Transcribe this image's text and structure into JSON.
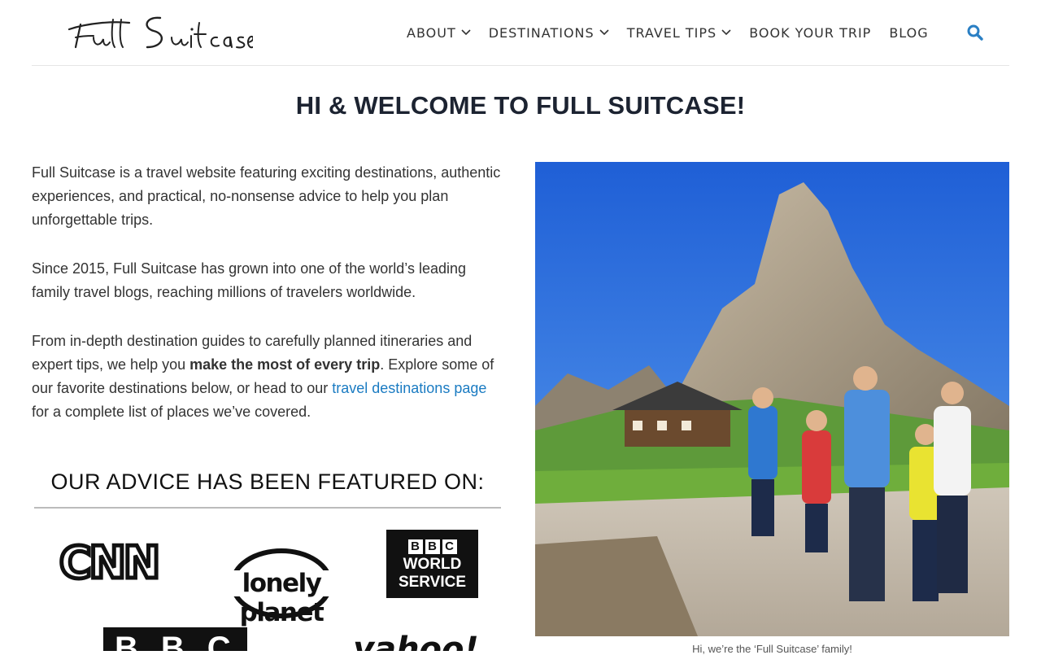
{
  "header": {
    "logo_text": "Full Suitcase",
    "nav": [
      {
        "label": "ABOUT",
        "has_dropdown": true
      },
      {
        "label": "DESTINATIONS",
        "has_dropdown": true
      },
      {
        "label": "TRAVEL TIPS",
        "has_dropdown": true
      },
      {
        "label": "BOOK YOUR TRIP",
        "has_dropdown": false
      },
      {
        "label": "BLOG",
        "has_dropdown": false
      }
    ],
    "search_icon": "search-icon"
  },
  "main": {
    "title": "HI & WELCOME TO FULL SUITCASE!",
    "p1": "Full Suitcase is a travel website featuring exciting destinations, authentic experiences, and practical, no-nonsense advice to help you plan unforgettable trips.",
    "p2": "Since 2015, Full Suitcase has grown into one of the world’s leading family travel blogs, reaching millions of travelers worldwide.",
    "p3_start": "From in-depth destination guides to carefully planned itineraries and expert tips, we help you ",
    "p3_bold": "make the most of every trip",
    "p3_mid": ". Explore some of our favorite destinations below, or head to our ",
    "p3_link": "travel destinations page",
    "p3_end": " for a complete list of places we’ve covered."
  },
  "featured": {
    "heading": "OUR ADVICE HAS BEEN FEATURED ON:",
    "logos": {
      "cnn": "CNN",
      "lonely_planet": "lonely planet",
      "bbc_ws_letters": [
        "B",
        "B",
        "C"
      ],
      "bbc_ws_line1": "WORLD",
      "bbc_ws_line2": "SERVICE",
      "bbc": "BBC",
      "yahoo": "yahoo!"
    }
  },
  "photo": {
    "caption": "Hi, we’re the ‘Full Suitcase’ family!"
  },
  "colors": {
    "link": "#1a7bc2",
    "search_icon": "#2a7fc4",
    "title": "#1c2331"
  }
}
